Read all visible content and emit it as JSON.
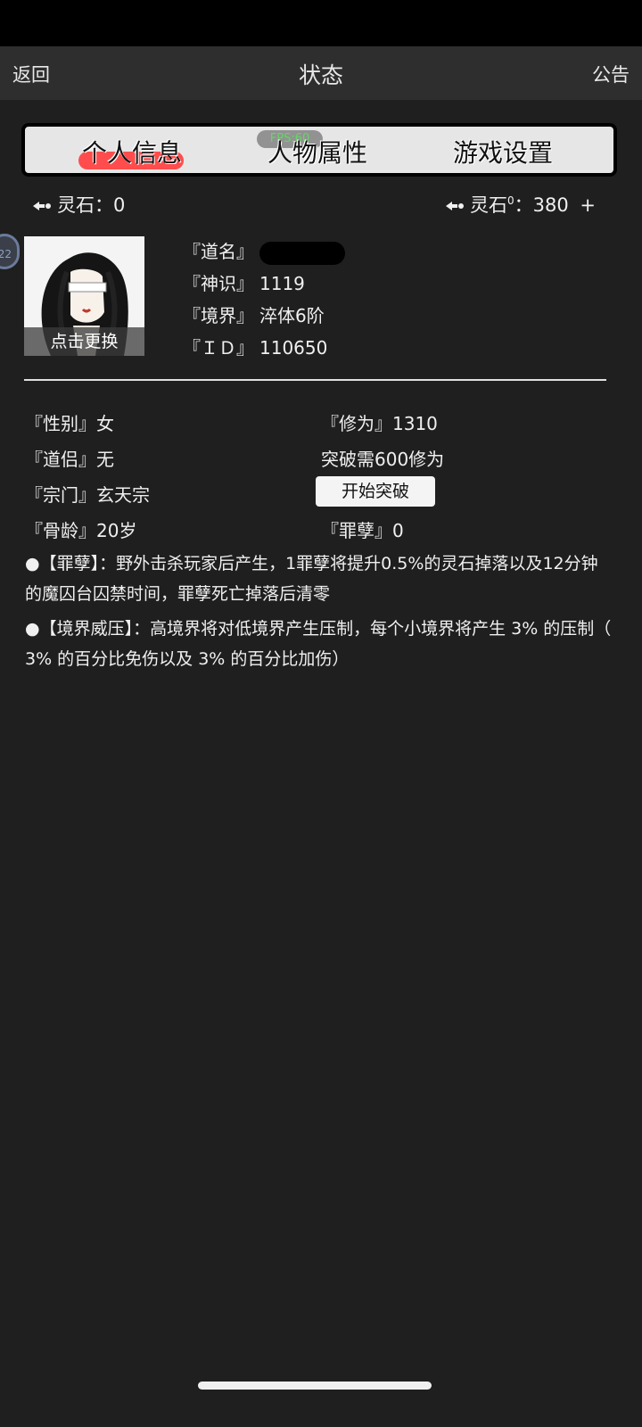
{
  "header": {
    "back_label": "返回",
    "title": "状态",
    "notice_label": "公告"
  },
  "tabs": [
    {
      "label": "个人信息",
      "active": true
    },
    {
      "label": "人物属性",
      "active": false
    },
    {
      "label": "游戏设置",
      "active": false
    }
  ],
  "fps_label": "FPS:60",
  "stones": {
    "left": {
      "label": "灵石：",
      "value": "0"
    },
    "right": {
      "label": "灵石",
      "sup": "0",
      "sep": "：",
      "value": "380",
      "add": "+"
    }
  },
  "side_bubble": "22",
  "avatar": {
    "caption": "点击更换"
  },
  "profile": {
    "name_label": "『道名』",
    "sense_label": "『神识』",
    "sense_value": "1119",
    "realm_label": "『境界』",
    "realm_value": "淬体6阶",
    "id_label": "『ＩＤ』",
    "id_value": "110650"
  },
  "attributes": {
    "gender": "『性别』女",
    "cultivation": "『修为』1310",
    "partner": "『道侣』无",
    "breakthrough_need": "突破需600修为",
    "sect": "『宗门』玄天宗",
    "breakthrough_button": "开始突破",
    "age": "『骨龄』20岁",
    "sin": "『罪孽』0"
  },
  "notes": [
    "●【罪孽】：野外击杀玩家后产生，1罪孽将提升0.5%的灵石掉落以及12分钟的魔囚台囚禁时间，罪孽死亡掉落后清零",
    "●【境界威压】：高境界将对低境界产生压制，每个小境界将产生 3% 的压制（ 3% 的百分比免伤以及 3% 的百分比加伤）"
  ],
  "colors": {
    "background": "#1f1f1f",
    "header": "#2e2e2e",
    "tab_bar": "#e6e6e6",
    "active_tab_highlight": "#ff4d4d",
    "fps_text": "#58d558"
  },
  "icons": {
    "stone": "spirit-stone-icon",
    "add": "plus-icon"
  }
}
